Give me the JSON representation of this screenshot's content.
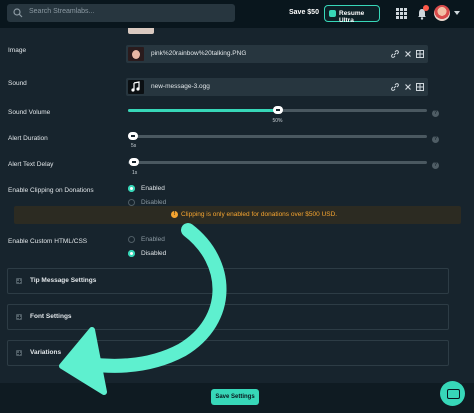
{
  "topbar": {
    "search_placeholder": "Search Streamlabs...",
    "save_label": "Save $50",
    "resume_label": "Resume Ultra"
  },
  "fields": {
    "image_label": "Image",
    "image_file": "pink%20rainbow%20talking.PNG",
    "sound_label": "Sound",
    "sound_file": "new-message-3.ogg",
    "volume_label": "Sound Volume",
    "volume_value_text": "50%",
    "volume_value": 0.5,
    "duration_label": "Alert Duration",
    "duration_value_text": "5s",
    "delay_label": "Alert Text Delay",
    "delay_value_text": "1s",
    "clipping_label": "Enable Clipping on Donations",
    "clipping_enabled": "Enabled",
    "clipping_disabled": "Disabled",
    "clipping_notice": "Clipping is only enabled for donations over $500 USD.",
    "custom_label": "Enable Custom HTML/CSS",
    "custom_enabled": "Enabled",
    "custom_disabled": "Disabled"
  },
  "sections": [
    {
      "title": "Tip Message Settings"
    },
    {
      "title": "Font Settings"
    },
    {
      "title": "Variations"
    }
  ],
  "footer": {
    "save_settings": "Save Settings"
  },
  "colors": {
    "accent": "#37d7b8",
    "warning": "#f6a530",
    "background": "#17242d"
  }
}
